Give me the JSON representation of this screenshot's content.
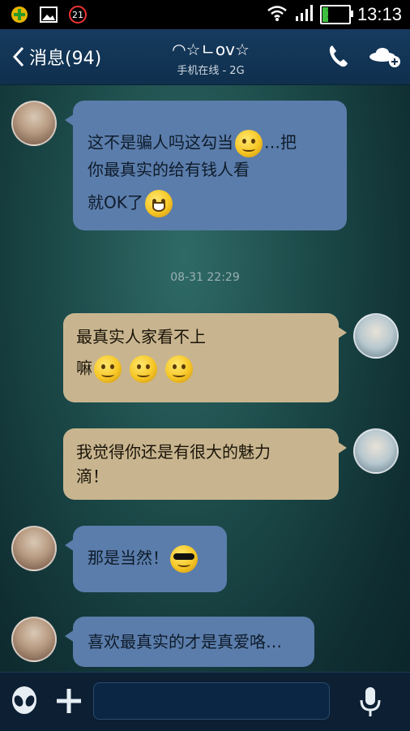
{
  "status_bar": {
    "notification_count": "21",
    "battery_level": "21",
    "battery_fraction": 0.21,
    "time": "13:13"
  },
  "header": {
    "back_label": "消息(94)",
    "contact_name": "◠☆ㄴov☆",
    "contact_status": "手机在线 - 2G"
  },
  "messages": [
    {
      "side": "left",
      "lines": [
        "这不是骗人吗这勾当",
        "…把",
        "你最真实的给有钱人看",
        "就OK了"
      ]
    },
    {
      "type": "timestamp",
      "text": "08-31 22:29"
    },
    {
      "side": "right",
      "lines": [
        "最真实人家看不上",
        "嘛"
      ]
    },
    {
      "side": "right",
      "lines": [
        "我觉得你还是有很大的魅力",
        "滴！"
      ]
    },
    {
      "side": "left",
      "lines": [
        "那是当然！"
      ]
    },
    {
      "side": "left",
      "lines": [
        "喜欢最真实的才是真爱咯…"
      ]
    }
  ],
  "input": {
    "value": ""
  },
  "colors": {
    "left_bubble": "#5b7dab",
    "right_bubble": "#c8b58f",
    "header": "#163b5e"
  }
}
